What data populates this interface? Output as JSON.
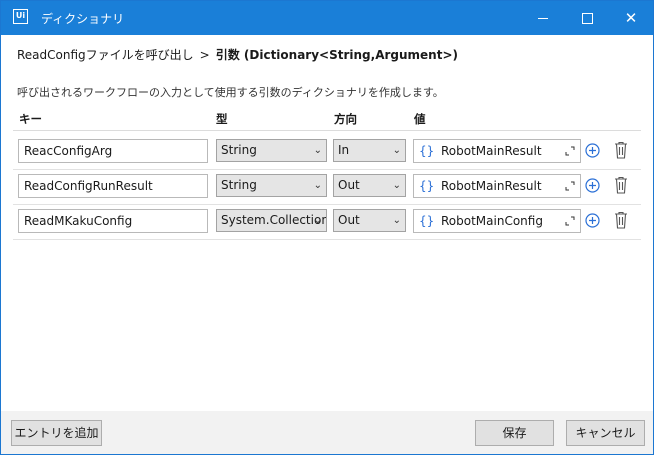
{
  "window": {
    "title": "ディクショナリ",
    "logo_text": "Ui",
    "controls": {
      "close_glyph": "✕"
    }
  },
  "breadcrumb": {
    "parent": "ReadConfigファイルを呼び出し",
    "separator": ">",
    "current": "引数 (Dictionary<String,Argument>)"
  },
  "description": "呼び出されるワークフローの入力として使用する引数のディクショナリを作成します。",
  "columns": {
    "key": "キー",
    "type": "型",
    "direction": "方向",
    "value": "値"
  },
  "rows": [
    {
      "name": "ReacConfigArg",
      "type": "String",
      "direction": "In",
      "value": "RobotMainResult"
    },
    {
      "name": "ReadConfigRunResult",
      "type": "String",
      "direction": "Out",
      "value": "RobotMainResult"
    },
    {
      "name": "ReadMKakuConfig",
      "type": "System.Collection",
      "direction": "Out",
      "value": "RobotMainConfig"
    }
  ],
  "value_prefix_glyph": "{}",
  "dropdown_glyph": "⌄",
  "footer": {
    "add_entry": "エントリを追加",
    "save": "保存",
    "cancel": "キャンセル"
  },
  "colors": {
    "titlebar": "#1a7fd8",
    "accent": "#2a6fd6"
  }
}
